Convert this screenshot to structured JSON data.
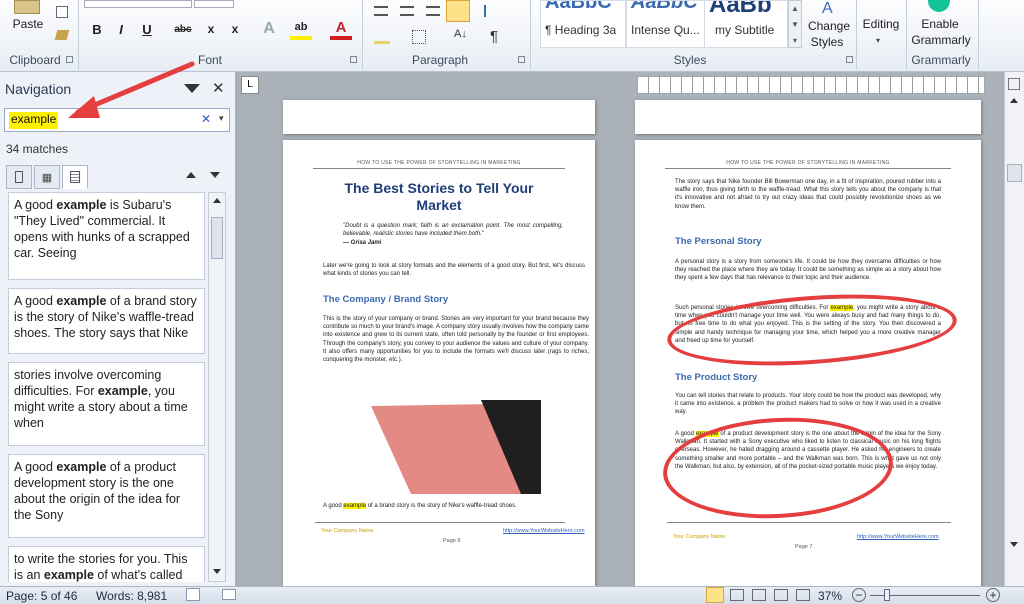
{
  "ribbon": {
    "clipboard": {
      "paste_label": "Paste",
      "group_label": "Clipboard"
    },
    "font": {
      "group_label": "Font",
      "buttons": [
        "B",
        "I",
        "U",
        "abc",
        "x",
        "x",
        "A",
        "ab",
        "A"
      ]
    },
    "paragraph": {
      "group_label": "Paragraph",
      "pilcrow": "¶"
    },
    "styles": {
      "group_label": "Styles",
      "items": [
        {
          "sample": "AaBbC",
          "label": "¶ Heading 3a"
        },
        {
          "sample": "AaBbC",
          "label": "Intense Qu..."
        },
        {
          "sample": "AaBb",
          "label": "my Subtitle"
        }
      ],
      "change_styles_line1": "Change",
      "change_styles_line2": "Styles"
    },
    "editing": {
      "label": "Editing"
    },
    "grammarly": {
      "line1": "Enable",
      "line2": "Grammarly",
      "group_label": "Grammarly"
    }
  },
  "navigation": {
    "title": "Navigation",
    "search_value": "example",
    "match_count": "34 matches",
    "results": [
      {
        "pre": "A good ",
        "bold": "example",
        "post": " is Subaru's \"They Lived\" commercial. It opens with hunks of a scrapped car. Seeing"
      },
      {
        "pre": "A good ",
        "bold": "example",
        "post": " of a brand story is the story of Nike's waffle-tread shoes. The story says that Nike"
      },
      {
        "pre": "stories involve overcoming difficulties. For ",
        "bold": "example",
        "post": ", you might write a story about a time when"
      },
      {
        "pre": "A good ",
        "bold": "example",
        "post": " of a product development story is the one about the origin of the idea for the Sony"
      },
      {
        "pre": "to write the stories for you. This is an ",
        "bold": "example",
        "post": " of what's called"
      }
    ]
  },
  "page6": {
    "header": "HOW TO USE THE POWER OF STORYTELLING IN MARKETING",
    "title": "The Best Stories to Tell Your Market",
    "quote": "\"Doubt is a question mark; faith is an exclamation point. The most compelling, believable, realistic stories have included them both.\"",
    "quote_author": "— Grisa Jami",
    "intro": "Later we're going to look at story formats and the elements of a good story. But first, let's discuss what kinds of stories you can tell.",
    "section": "The Company / Brand Story",
    "body": "This is the story of your company or brand. Stories are very important for your brand because they contribute so much to your brand's image. A company story usually involves how the company came into existence and grew to its current state, often told personally by the founder or first employees. Through the company's story, you convey to your audience the values and culture of your company. It also offers many opportunities for you to include the formats we'll discuss later (rags to riches, conquering the monster, etc.).",
    "caption_pre": "A good ",
    "caption_hl": "example",
    "caption_post": " of a brand story is the story of Nike's waffle-tread shoes.",
    "footer_left": "Your Company Name",
    "footer_center": "Page 6",
    "footer_right": "http://www.YourWebsiteHere.com"
  },
  "page7": {
    "header": "HOW TO USE THE POWER OF STORYTELLING IN MARKETING",
    "p1": "The story says that Nike founder Bill Bowerman one day, in a fit of inspiration, poured rubber into a waffle iron, thus giving birth to the waffle-tread. What this story tells you about the company is that it's innovative and not afraid to try out crazy ideas that could possibly revolutionize shoes as we know them.",
    "section1": "The Personal Story",
    "p2": "A personal story is a story from someone's life. It could be how they overcame difficulties or how they reached the place where they are today. It could be something as simple as a story about how they spent a few days that has relevance to their topic and their audience.",
    "p3_pre": "Such personal stories involve overcoming difficulties. For ",
    "p3_hl": "example",
    "p3_post": ", you might write a story about a time when you couldn't manage your time well. You were always busy and had many things to do, but no free time to do what you enjoyed. This is the setting of the story. You then discovered a simple and handy technique for managing your time, which helped you a more creative manager and freed up time for yourself.",
    "section2": "The Product Story",
    "p4": "You can tell stories that relate to products. Your story could be how the product was developed, why it came into existence, a problem the product makers had to solve or how it was used in a creative way.",
    "p5_pre": "A good ",
    "p5_hl": "example",
    "p5_post": " of a product development story is the one about the origin of the idea for the Sony Walkman. It started with a Sony executive who liked to listen to classical music on his long flights overseas. However, he hated dragging around a cassette player. He asked his engineers to create something smaller and more portable – and the Walkman was born. This is what gave us not only the Walkman, but also, by extension, all of the pocket-sized portable music players we enjoy today.",
    "footer_left": "Your Company Name",
    "footer_center": "Page 7",
    "footer_right": "http://www.YourWebsiteHere.com"
  },
  "status": {
    "page": "Page: 5 of 46",
    "words": "Words: 8,981",
    "zoom": "37%"
  },
  "colors": {
    "accent": "#3a6ab0",
    "highlight": "#fff200",
    "annotation": "#e43e3e"
  }
}
